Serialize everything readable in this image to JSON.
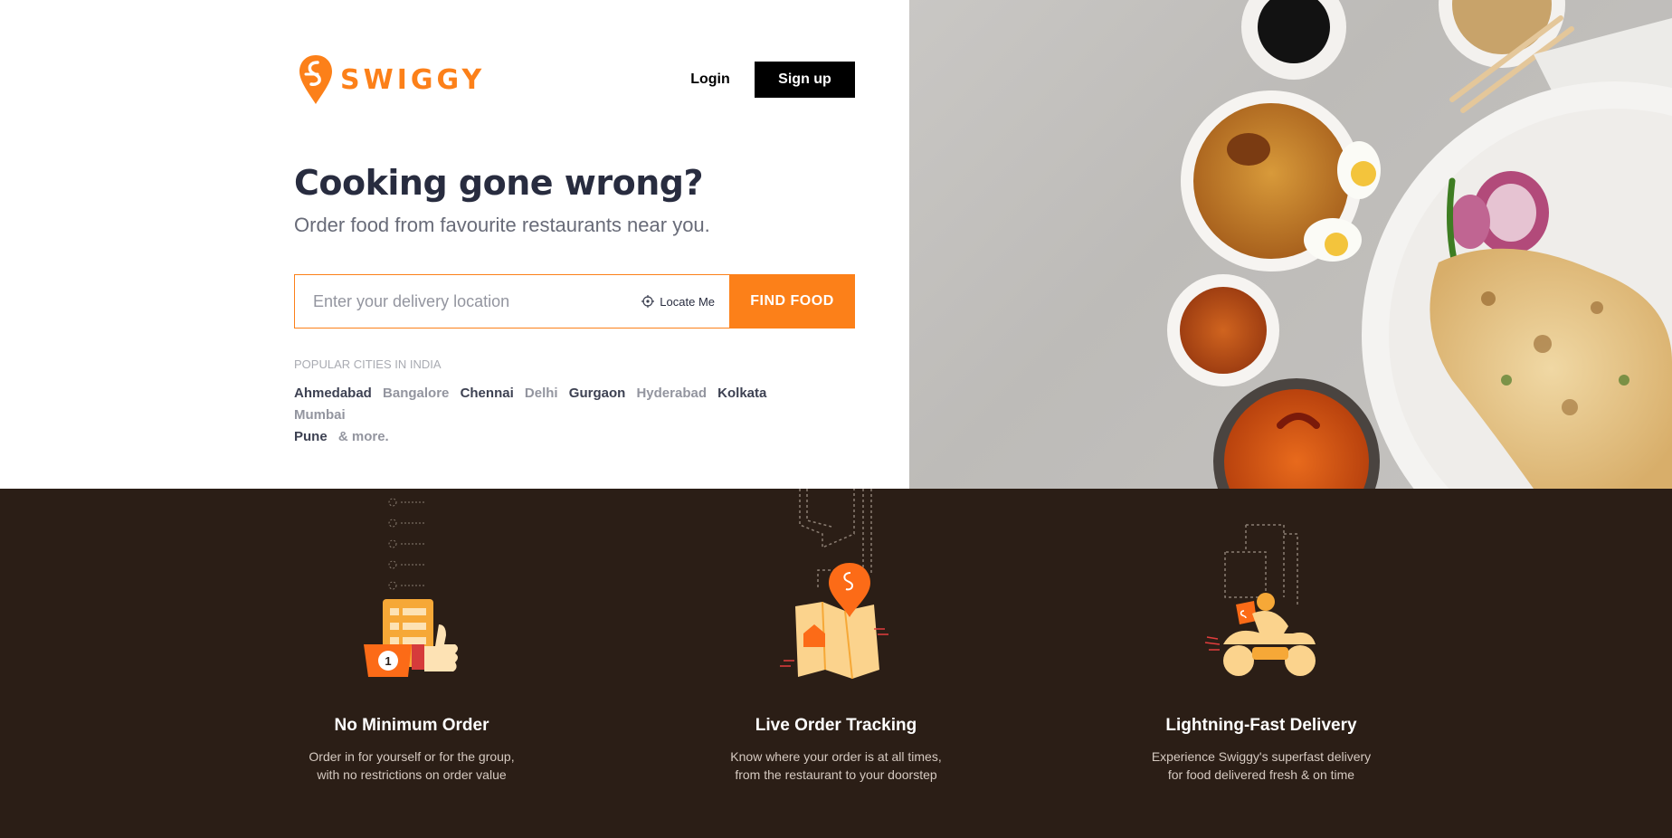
{
  "brand": {
    "name": "SWIGGY",
    "color": "#fc8019"
  },
  "header": {
    "login_label": "Login",
    "signup_label": "Sign up"
  },
  "hero": {
    "title": "Cooking gone wrong?",
    "subtitle": "Order food from favourite restaurants near you."
  },
  "search": {
    "placeholder": "Enter your delivery location",
    "locate_label": "Locate Me",
    "find_label": "FIND FOOD"
  },
  "cities": {
    "title": "POPULAR CITIES IN INDIA",
    "items": [
      "Ahmedabad",
      "Bangalore",
      "Chennai",
      "Delhi",
      "Gurgaon",
      "Hyderabad",
      "Kolkata",
      "Mumbai",
      "Pune"
    ],
    "more_label": "& more."
  },
  "features": [
    {
      "title": "No Minimum Order",
      "desc1": "Order in for yourself or for the group,",
      "desc2": "with no restrictions on order value",
      "icon": "thumbs-up-order-icon"
    },
    {
      "title": "Live Order Tracking",
      "desc1": "Know where your order is at all times,",
      "desc2": "from the restaurant to your doorstep",
      "icon": "map-pin-tracking-icon"
    },
    {
      "title": "Lightning-Fast Delivery",
      "desc1": "Experience Swiggy's superfast delivery",
      "desc2": "for food delivered fresh & on time",
      "icon": "delivery-scooter-icon"
    }
  ],
  "colors": {
    "accent": "#fc8019",
    "dark_band": "#2b1e16",
    "headline": "#282c3f"
  }
}
